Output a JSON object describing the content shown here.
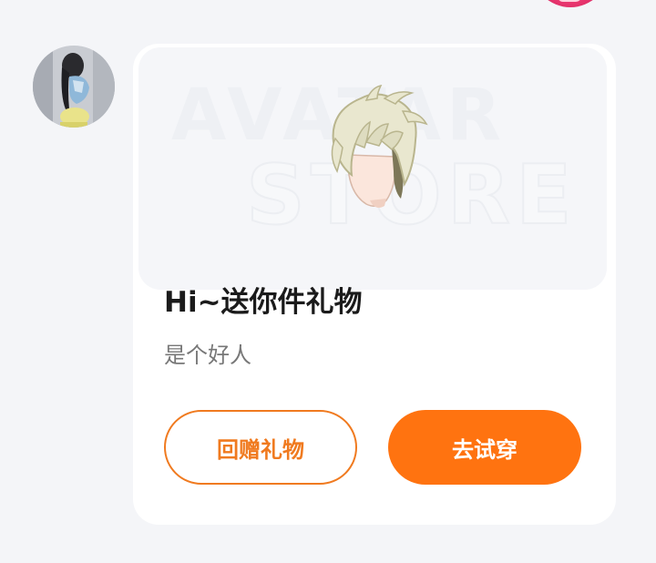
{
  "banner": {
    "watermark_line1": "AVATAR",
    "watermark_line2": "STORE"
  },
  "message": {
    "title": "Hi~送你件礼物",
    "subtitle": "是个好人"
  },
  "actions": {
    "return_gift_label": "回赠礼物",
    "try_on_label": "去试穿"
  },
  "colors": {
    "accent": "#ff7310",
    "accent_outline": "#f07a1f",
    "background": "#f4f5f8",
    "card": "#ffffff"
  },
  "icons": {
    "item_preview": "hairstyle-item-icon"
  }
}
